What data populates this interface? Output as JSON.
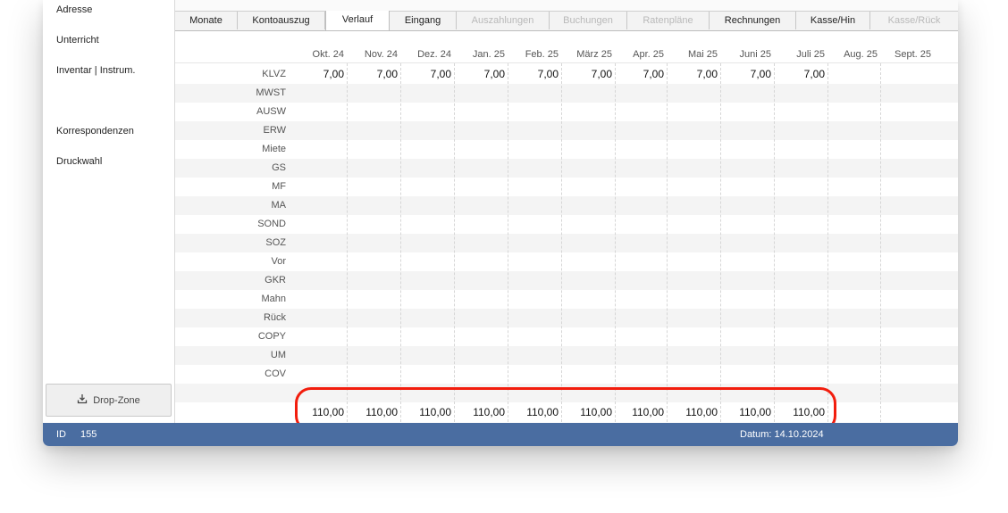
{
  "sidebar": {
    "items": [
      {
        "label": "Adresse"
      },
      {
        "label": "Unterricht"
      },
      {
        "label": "Inventar | Instrum."
      },
      {
        "label": "Korrespondenzen"
      },
      {
        "label": "Druckwahl"
      }
    ],
    "dropzone_label": "Drop-Zone",
    "dropzone_icon": "download-tray-icon"
  },
  "tabs": [
    {
      "label": "Monate",
      "enabled": true
    },
    {
      "label": "Kontoauszug",
      "enabled": true
    },
    {
      "label": "Verlauf",
      "enabled": true,
      "active": true
    },
    {
      "label": "Eingang",
      "enabled": true
    },
    {
      "label": "Auszahlungen",
      "enabled": false
    },
    {
      "label": "Buchungen",
      "enabled": false
    },
    {
      "label": "Ratenpläne",
      "enabled": false
    },
    {
      "label": "Rechnungen",
      "enabled": true
    },
    {
      "label": "Kasse/Hin",
      "enabled": true
    },
    {
      "label": "Kasse/Rück",
      "enabled": false
    }
  ],
  "months": [
    "Okt. 24",
    "Nov. 24",
    "Dez. 24",
    "Jan. 25",
    "Feb. 25",
    "März 25",
    "Apr. 25",
    "Mai 25",
    "Juni 25",
    "Juli 25",
    "Aug. 25",
    "Sept. 25"
  ],
  "rows": [
    {
      "label": "KLVZ",
      "values": [
        "7,00",
        "7,00",
        "7,00",
        "7,00",
        "7,00",
        "7,00",
        "7,00",
        "7,00",
        "7,00",
        "7,00",
        "",
        ""
      ]
    },
    {
      "label": "MWST",
      "values": []
    },
    {
      "label": "AUSW",
      "values": []
    },
    {
      "label": "ERW",
      "values": []
    },
    {
      "label": "Miete",
      "values": []
    },
    {
      "label": "GS",
      "values": []
    },
    {
      "label": "MF",
      "values": []
    },
    {
      "label": "MA",
      "values": []
    },
    {
      "label": "SOND",
      "values": []
    },
    {
      "label": "SOZ",
      "values": []
    },
    {
      "label": "Vor",
      "values": []
    },
    {
      "label": "GKR",
      "values": []
    },
    {
      "label": "Mahn",
      "values": []
    },
    {
      "label": "Rück",
      "values": []
    },
    {
      "label": "COPY",
      "values": []
    },
    {
      "label": "UM",
      "values": []
    },
    {
      "label": "COV",
      "values": []
    }
  ],
  "totals": [
    "110,00",
    "110,00",
    "110,00",
    "110,00",
    "110,00",
    "110,00",
    "110,00",
    "110,00",
    "110,00",
    "110,00"
  ],
  "status": {
    "id_label": "ID",
    "id_value": "155",
    "date": "Datum: 14.10.2024"
  },
  "colors": {
    "statusbar": "#4a6da1",
    "highlight": "#f21d0d"
  }
}
